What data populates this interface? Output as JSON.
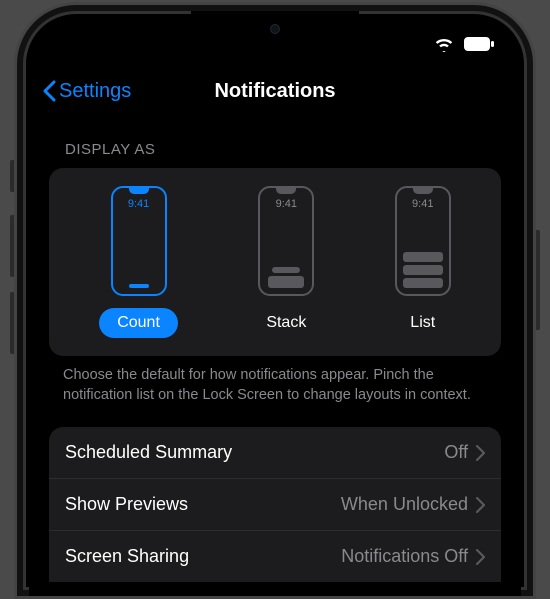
{
  "colors": {
    "accent": "#0a84ff",
    "card": "#1c1c1e",
    "muted": "#8a8a8e"
  },
  "nav": {
    "back_label": "Settings",
    "title": "Notifications"
  },
  "display_section": {
    "header": "Display As",
    "preview_time": "9:41",
    "options": [
      {
        "label": "Count",
        "selected": true
      },
      {
        "label": "Stack",
        "selected": false
      },
      {
        "label": "List",
        "selected": false
      }
    ],
    "footer": "Choose the default for how notifications appear. Pinch the notification list on the Lock Screen to change layouts in context."
  },
  "rows": [
    {
      "label": "Scheduled Summary",
      "value": "Off"
    },
    {
      "label": "Show Previews",
      "value": "When Unlocked"
    },
    {
      "label": "Screen Sharing",
      "value": "Notifications Off"
    }
  ]
}
